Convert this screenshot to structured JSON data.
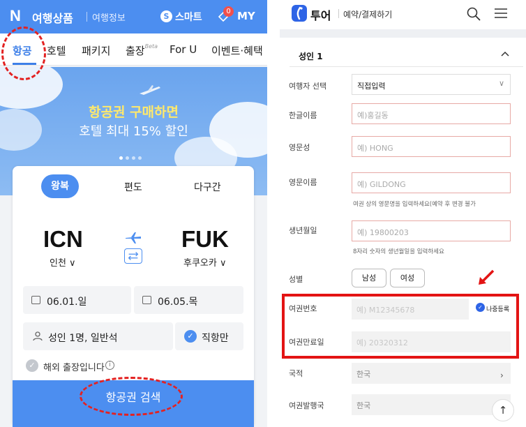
{
  "left": {
    "topbar": {
      "logo": "N",
      "brand": "여행상품",
      "sub": "여행정보",
      "smart_icon": "S",
      "smart": "스마트",
      "badge": "0",
      "my": "MY"
    },
    "tabs": [
      {
        "label": "항공",
        "active": true
      },
      {
        "label": "호텔"
      },
      {
        "label": "패키지"
      },
      {
        "label": "출장"
      },
      {
        "label": "For U"
      },
      {
        "label": "이벤트·혜택"
      }
    ],
    "tab_beta": "Beta",
    "banner": {
      "line1": "항공권 구매하면",
      "line2": "호텔 최대 15% 할인"
    },
    "trip_types": [
      "왕복",
      "편도",
      "다구간"
    ],
    "origin": {
      "code": "ICN",
      "city": "인천"
    },
    "destination": {
      "code": "FUK",
      "city": "후쿠오카"
    },
    "depart_date": "06.01.일",
    "return_date": "06.05.목",
    "passengers": "성인 1명, 일반석",
    "direct_only": "직항만",
    "business_trip": "해외 출장입니다",
    "info_icon": "i",
    "search_button": "항공권 검색"
  },
  "right": {
    "header": {
      "brand": "투어",
      "sub": "예약/결제하기"
    },
    "section_title": "성인 1",
    "fields": {
      "traveler_select_label": "여행자 선택",
      "traveler_select_value": "직접입력",
      "kor_name_label": "한글이름",
      "kor_name_placeholder": "예)홍길동",
      "eng_last_label": "영문성",
      "eng_last_placeholder": "예) HONG",
      "eng_first_label": "영문이름",
      "eng_first_placeholder": "예) GILDONG",
      "eng_help": "여권 상의 영문명을 입력하세요(예약 후 변경 불가",
      "birth_label": "생년월일",
      "birth_placeholder": "예) 19800203",
      "birth_help": "8자리 숫자의 생년월일을 입력하세요",
      "gender_label": "성별",
      "gender_male": "남성",
      "gender_female": "여성",
      "passport_label": "여권번호",
      "passport_placeholder": "예) M12345678",
      "later_label": "나중등록",
      "passport_exp_label": "여권만료일",
      "passport_exp_placeholder": "예) 20320312",
      "nationality_label": "국적",
      "nationality_value": "한국",
      "issuer_label": "여권발행국",
      "issuer_value": "한국"
    }
  },
  "colors": {
    "accent": "#4c8ef0",
    "highlight": "#e31414",
    "tour_brand": "#2e64e6"
  }
}
